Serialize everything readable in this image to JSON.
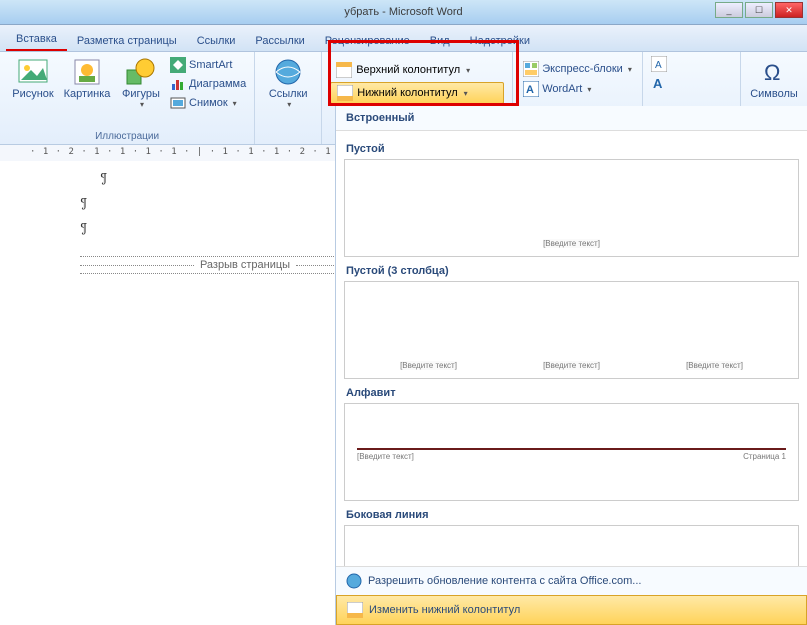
{
  "title_doc": "убрать",
  "title_app": "Microsoft Word",
  "tabs": {
    "insert": "Вставка",
    "pagelayout": "Разметка страницы",
    "references": "Ссылки",
    "mailings": "Рассылки",
    "review": "Рецензирование",
    "view": "Вид",
    "addins": "Надстройки"
  },
  "ribbon": {
    "picture": "Рисунок",
    "clipart": "Картинка",
    "shapes": "Фигуры",
    "smartart": "SmartArt",
    "chart": "Диаграмма",
    "screenshot": "Снимок",
    "illustrations_label": "Иллюстрации",
    "links": "Ссылки",
    "header": "Верхний колонтитул",
    "footer": "Нижний колонтитул",
    "quickparts": "Экспресс-блоки",
    "wordart": "WordArt",
    "symbols": "Символы"
  },
  "doc": {
    "page_break": "Разрыв страницы",
    "pilcrow": "¶"
  },
  "gallery": {
    "builtin": "Встроенный",
    "blank": "Пустой",
    "blank3": "Пустой (3 столбца)",
    "alphabet": "Алфавит",
    "sideline": "Боковая линия",
    "placeholder": "[Введите текст]",
    "page_n": "Страница 1",
    "enable_update": "Разрешить обновление контента с сайта Office.com...",
    "edit_footer": "Изменить нижний колонтитул"
  }
}
